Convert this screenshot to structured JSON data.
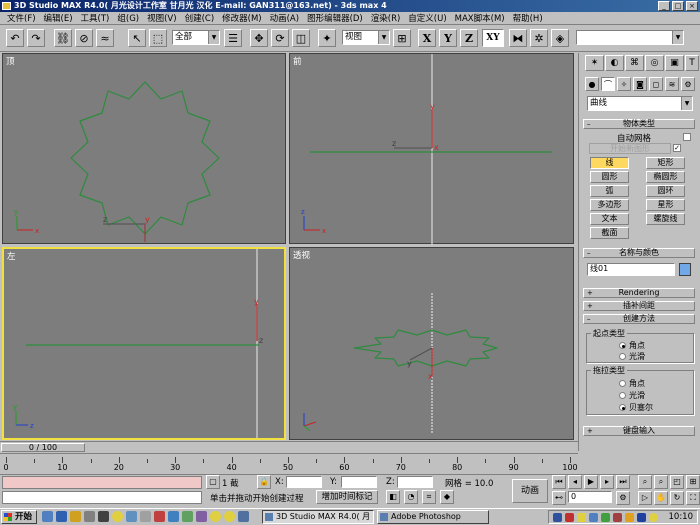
{
  "window": {
    "title": "3D Studio MAX R4.0( 月光设计工作室 甘月光 汉化  E-mail: GAN311@163.net) - 3ds max 4",
    "min": "_",
    "max": "□",
    "close": "×"
  },
  "menu": [
    "文件(F)",
    "编辑(E)",
    "工具(T)",
    "组(G)",
    "视图(V)",
    "创建(C)",
    "修改器(M)",
    "动画(A)",
    "图形编辑器(D)",
    "渲染(R)",
    "自定义(U)",
    "MAX脚本(M)",
    "帮助(H)"
  ],
  "toolbar": {
    "selection_filter": "全部",
    "ref_coord": "视图",
    "axis_x": "X",
    "axis_y": "Y",
    "axis_z": "Z",
    "axis_xy": "XY",
    "named_sel": ""
  },
  "viewports": {
    "top": "顶",
    "front": "前",
    "left": "左",
    "perspective": "透视"
  },
  "command_panel": {
    "tabs_icons": [
      "create-icon",
      "modify-icon",
      "hierarchy-icon",
      "motion-icon",
      "display-icon",
      "utilities-icon"
    ],
    "category": "曲线",
    "object_type": {
      "header": "物体类型",
      "autogrid": "自动网格",
      "start_new_shape": "开始新图形",
      "buttons": [
        "线",
        "矩形",
        "圆形",
        "椭圆形",
        "弧",
        "圆环",
        "多边形",
        "星形",
        "文本",
        "螺旋线",
        "截面"
      ]
    },
    "name_color": {
      "header": "名称与颜色",
      "name": "线01",
      "color": "#70a8e8"
    },
    "rendering": "Rendering",
    "interpolation": "插补间距",
    "creation_method": {
      "header": "创建方法",
      "initial_type": "起点类型",
      "initial_options": [
        "角点",
        "光滑"
      ],
      "initial_selected": 0,
      "drag_type": "拖拉类型",
      "drag_options": [
        "角点",
        "光滑",
        "贝塞尔"
      ],
      "drag_selected": 2
    },
    "keyboard_entry": "键盘输入"
  },
  "timeline": {
    "slider": "0 / 100",
    "ruler_labels": [
      "0",
      "10",
      "20",
      "30",
      "40",
      "50",
      "60",
      "70",
      "80",
      "90",
      "100"
    ]
  },
  "status": {
    "selection": "1 截",
    "prompt": "单击并拖动开始创建过程",
    "add_time_tag": "增加时间标记",
    "x_label": "X:",
    "y_label": "Y:",
    "z_label": "Z:",
    "grid": "网格 = 10.0",
    "animate": "动画",
    "frame": "0"
  },
  "taskbar": {
    "start": "开始",
    "tasks": [
      "3D Studio MAX R4.0( 月",
      "Adobe Photoshop"
    ],
    "time": "10:10"
  },
  "colors": {
    "viewport_bg": "#7d7d7d",
    "active_border": "#f0e040",
    "shape": "#2e8b3e",
    "highlight_btn": "#ffd860"
  }
}
